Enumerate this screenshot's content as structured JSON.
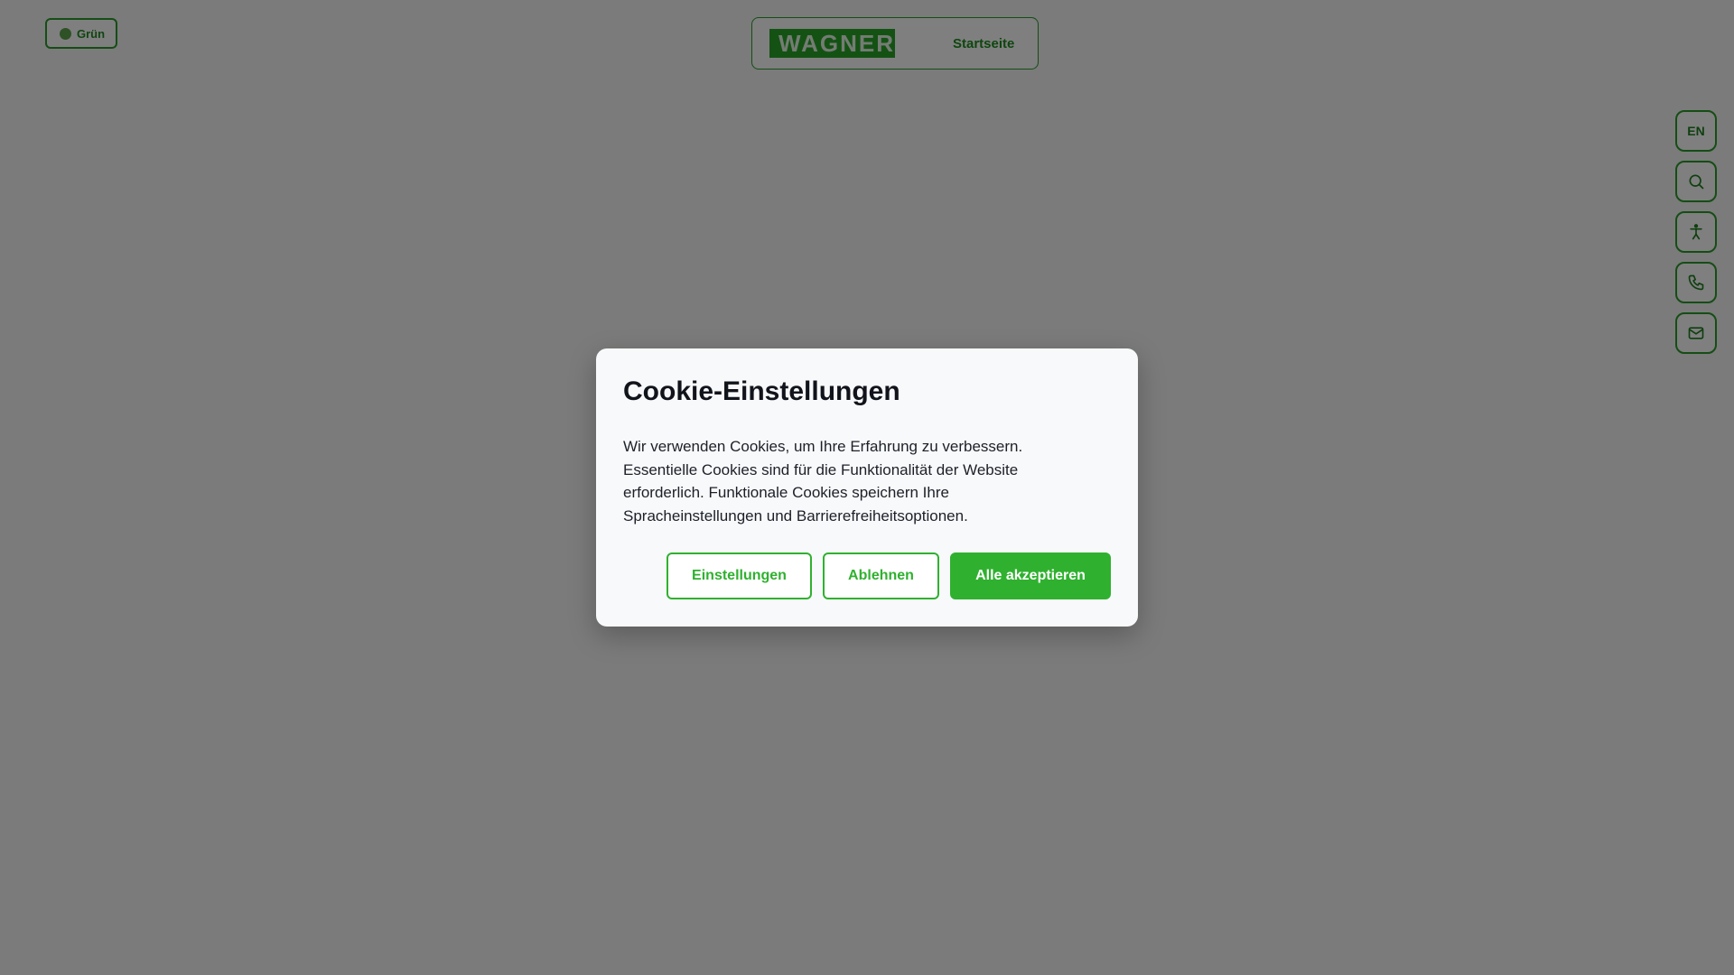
{
  "theme_toggle": {
    "label": "Grün",
    "dot_color": "#5fa34d"
  },
  "header": {
    "logo_text": "WAGNER",
    "nav_link": "Startseite"
  },
  "side_rail": {
    "language_label": "EN",
    "icons": [
      "search-icon",
      "accessibility-icon",
      "phone-icon",
      "mail-icon"
    ]
  },
  "cookie_dialog": {
    "title": "Cookie-Einstellungen",
    "body": "Wir verwenden Cookies, um Ihre Erfahrung zu verbessern. Essentielle Cookies sind für die Funktionalität der Website erforderlich. Funktionale Cookies speichern Ihre Spracheinstellungen und Barrierefreiheitsoptionen.",
    "settings_button": "Einstellungen",
    "decline_button": "Ablehnen",
    "accept_button": "Alle akzeptieren"
  },
  "colors": {
    "accent": "#2fb12f",
    "logo_bg": "#28a428",
    "overlay": "rgba(0,0,0,0.5)"
  }
}
